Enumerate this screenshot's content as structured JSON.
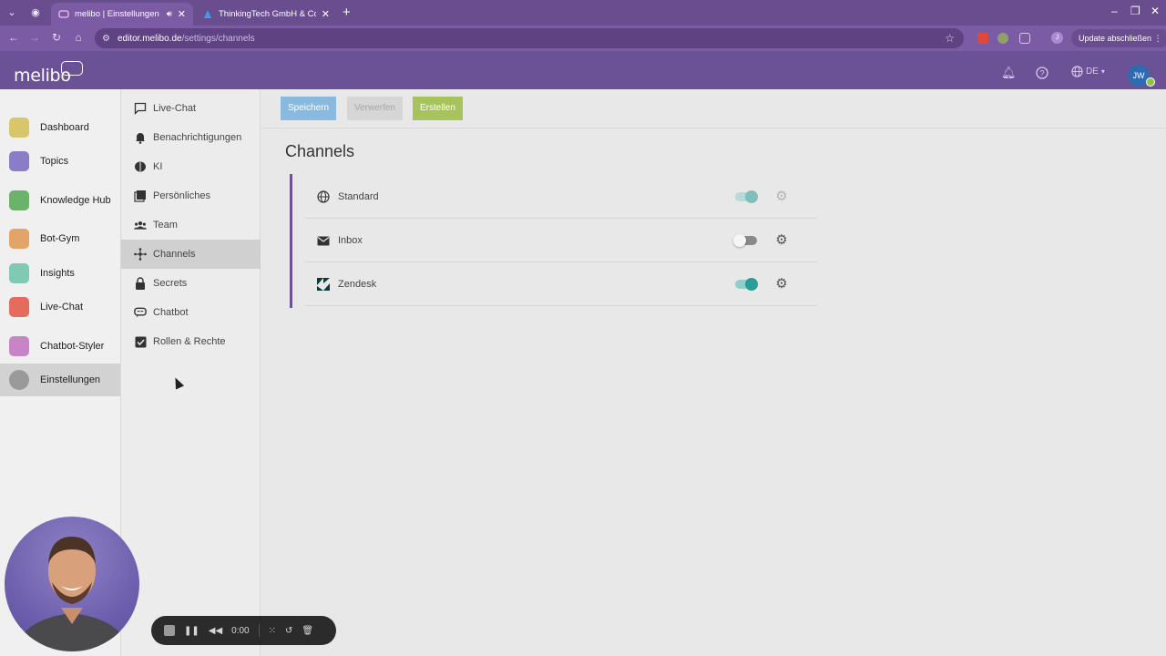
{
  "browser": {
    "tabs": [
      {
        "title": "melibo | Einstellungen",
        "active": true
      },
      {
        "title": "ThinkingTech GmbH & Co.",
        "active": false
      }
    ],
    "url_host": "editor.melibo.de",
    "url_path": "/settings/channels",
    "update_label": "Update abschließen",
    "profile_initial": "J"
  },
  "header": {
    "logo": "melibo",
    "language": "DE",
    "user_initials": "JW"
  },
  "leftnav": {
    "items": [
      {
        "label": "Dashboard",
        "icon": "dashboard-icon",
        "color": "#d8c66a",
        "active": false
      },
      {
        "label": "Topics",
        "icon": "topics-icon",
        "color": "#8b7cc8",
        "active": false
      },
      {
        "label": "Knowledge Hub",
        "icon": "knowledge-hub-icon",
        "color": "#6bb36b",
        "active": false
      },
      {
        "label": "Bot-Gym",
        "icon": "bot-gym-icon",
        "color": "#e2a468",
        "active": false
      },
      {
        "label": "Insights",
        "icon": "insights-icon",
        "color": "#7fc9b5",
        "active": false
      },
      {
        "label": "Live-Chat",
        "icon": "live-chat-icon",
        "color": "#e56b5f",
        "active": false
      },
      {
        "label": "Chatbot-Styler",
        "icon": "chatbot-styler-icon",
        "color": "#c785c7",
        "active": false
      },
      {
        "label": "Einstellungen",
        "icon": "settings-icon",
        "color": "#9a9a9a",
        "active": true
      }
    ]
  },
  "settings_menu": {
    "items": [
      {
        "label": "Live-Chat",
        "icon": "chat-bubble-icon",
        "active": false
      },
      {
        "label": "Benachrichtigungen",
        "icon": "bell-icon",
        "active": false
      },
      {
        "label": "KI",
        "icon": "brain-icon",
        "active": false
      },
      {
        "label": "Persönliches",
        "icon": "profile-card-icon",
        "active": false
      },
      {
        "label": "Team",
        "icon": "team-icon",
        "active": false
      },
      {
        "label": "Channels",
        "icon": "channels-icon",
        "active": true
      },
      {
        "label": "Secrets",
        "icon": "lock-icon",
        "active": false
      },
      {
        "label": "Chatbot",
        "icon": "chatbot-icon",
        "active": false
      },
      {
        "label": "Rollen & Rechte",
        "icon": "checkbox-icon",
        "active": false
      }
    ]
  },
  "actions": {
    "save_label": "Speichern",
    "discard_label": "Verwerfen",
    "create_label": "Erstellen"
  },
  "main": {
    "title": "Channels",
    "channels": [
      {
        "name": "Standard",
        "icon": "globe-icon",
        "enabled": true,
        "dimmed": true
      },
      {
        "name": "Inbox",
        "icon": "mail-icon",
        "enabled": false,
        "dimmed": false
      },
      {
        "name": "Zendesk",
        "icon": "zendesk-icon",
        "enabled": true,
        "dimmed": false
      }
    ]
  },
  "recorder": {
    "time": "0:00"
  },
  "colors": {
    "brand_purple": "#6b5195",
    "toggle_on": "#2a9d96",
    "save_button": "#8ab9e0",
    "create_button": "#a6c35c"
  }
}
